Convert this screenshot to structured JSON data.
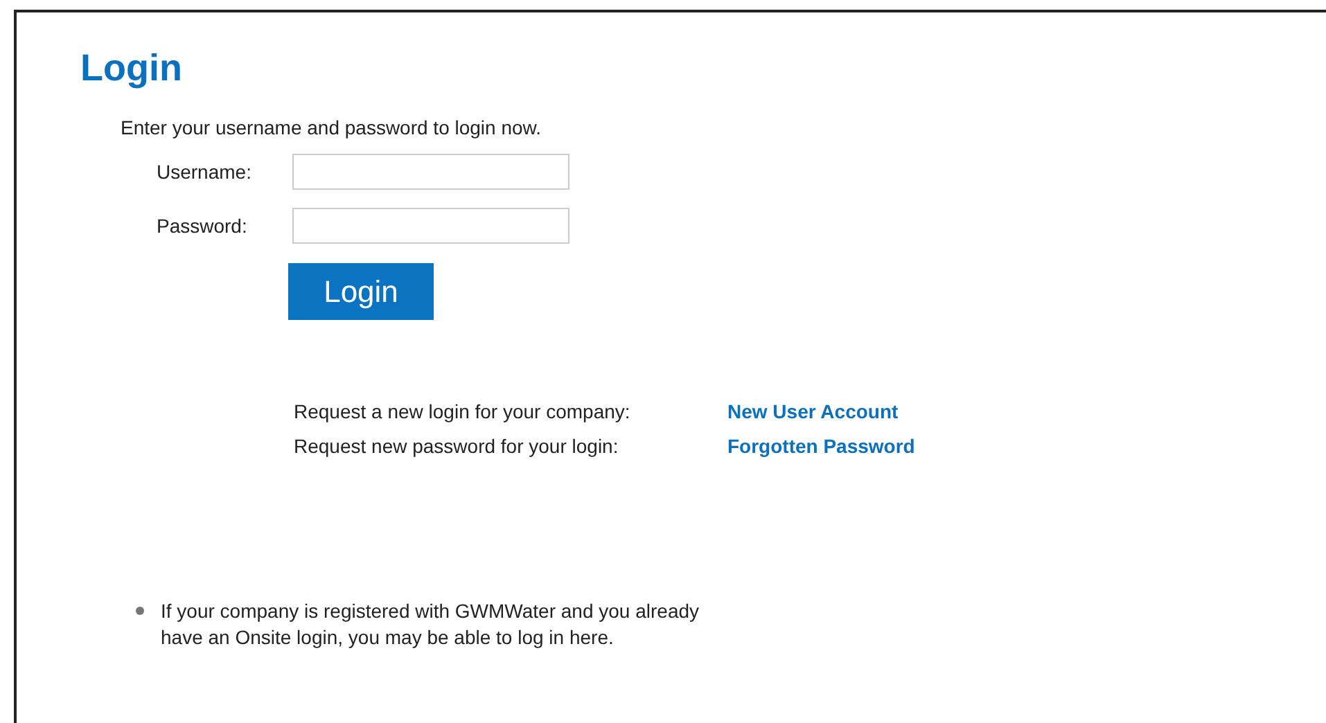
{
  "title": "Login",
  "intro": "Enter your username and password to login now.",
  "fields": [
    {
      "label": "Username:"
    },
    {
      "label": "Password:"
    }
  ],
  "submit_button": "Login",
  "requests": [
    {
      "text": "Request a new login for your company:",
      "link": "New User Account"
    },
    {
      "text": "Request new password for your login:",
      "link": "Forgotten Password"
    }
  ],
  "notes": [
    "If your company is registered with GWMWater and you already have an Onsite login, you may be able to log in here."
  ]
}
